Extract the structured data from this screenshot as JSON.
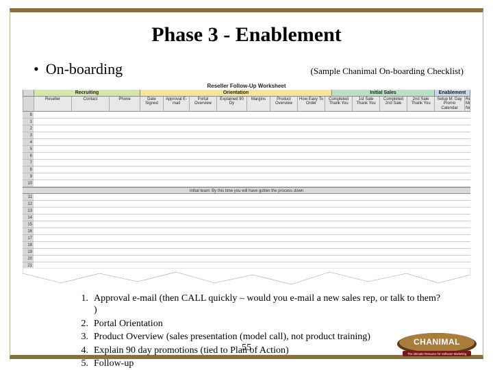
{
  "title": "Phase 3 - Enablement",
  "bullet": "On-boarding",
  "caption": "(Sample Chanimal On-boarding Checklist)",
  "sheet": {
    "title": "Reseller Follow-Up Worksheet",
    "groups": {
      "a": "Recruiting",
      "b": "Orientation",
      "c": "Initial Sales",
      "d": "Enablement"
    },
    "headers": [
      "",
      "Reseller",
      "Contact",
      "Phone",
      "Date Signed",
      "Approval E-mail",
      "Portal Overview",
      "Explained 90 Dy",
      "Margins",
      "Product Overview",
      "How Easy To Order",
      "Completed Thank You",
      "1st Sale Thank You",
      "Completed 2nd Sale",
      "2nd Sale Thank You",
      "Setup M. Day Promo Calendar",
      "Received Monthly Newsletter"
    ],
    "row_numbers_top": [
      "8",
      "1",
      "2",
      "3",
      "4",
      "5",
      "6",
      "7",
      "8",
      "9",
      "10"
    ],
    "initial_team": "Initial team: By this time you will have gotten the process down",
    "row_numbers_bottom": [
      "11",
      "12",
      "13",
      "14",
      "15",
      "16",
      "17",
      "18",
      "19",
      "20",
      "21"
    ]
  },
  "steps": [
    "Approval e-mail (then CALL quickly – would you e-mail a new sales rep, or talk to them? )",
    "Portal Orientation",
    "Product Overview (sales presentation (model call), not product training)",
    "Explain 90 day promotions (tied to Plan of Action)",
    "Follow-up"
  ],
  "page": "55",
  "logo": {
    "name": "CHANIMAL",
    "tag": "The Ultimate Resource for Software Marketing"
  }
}
